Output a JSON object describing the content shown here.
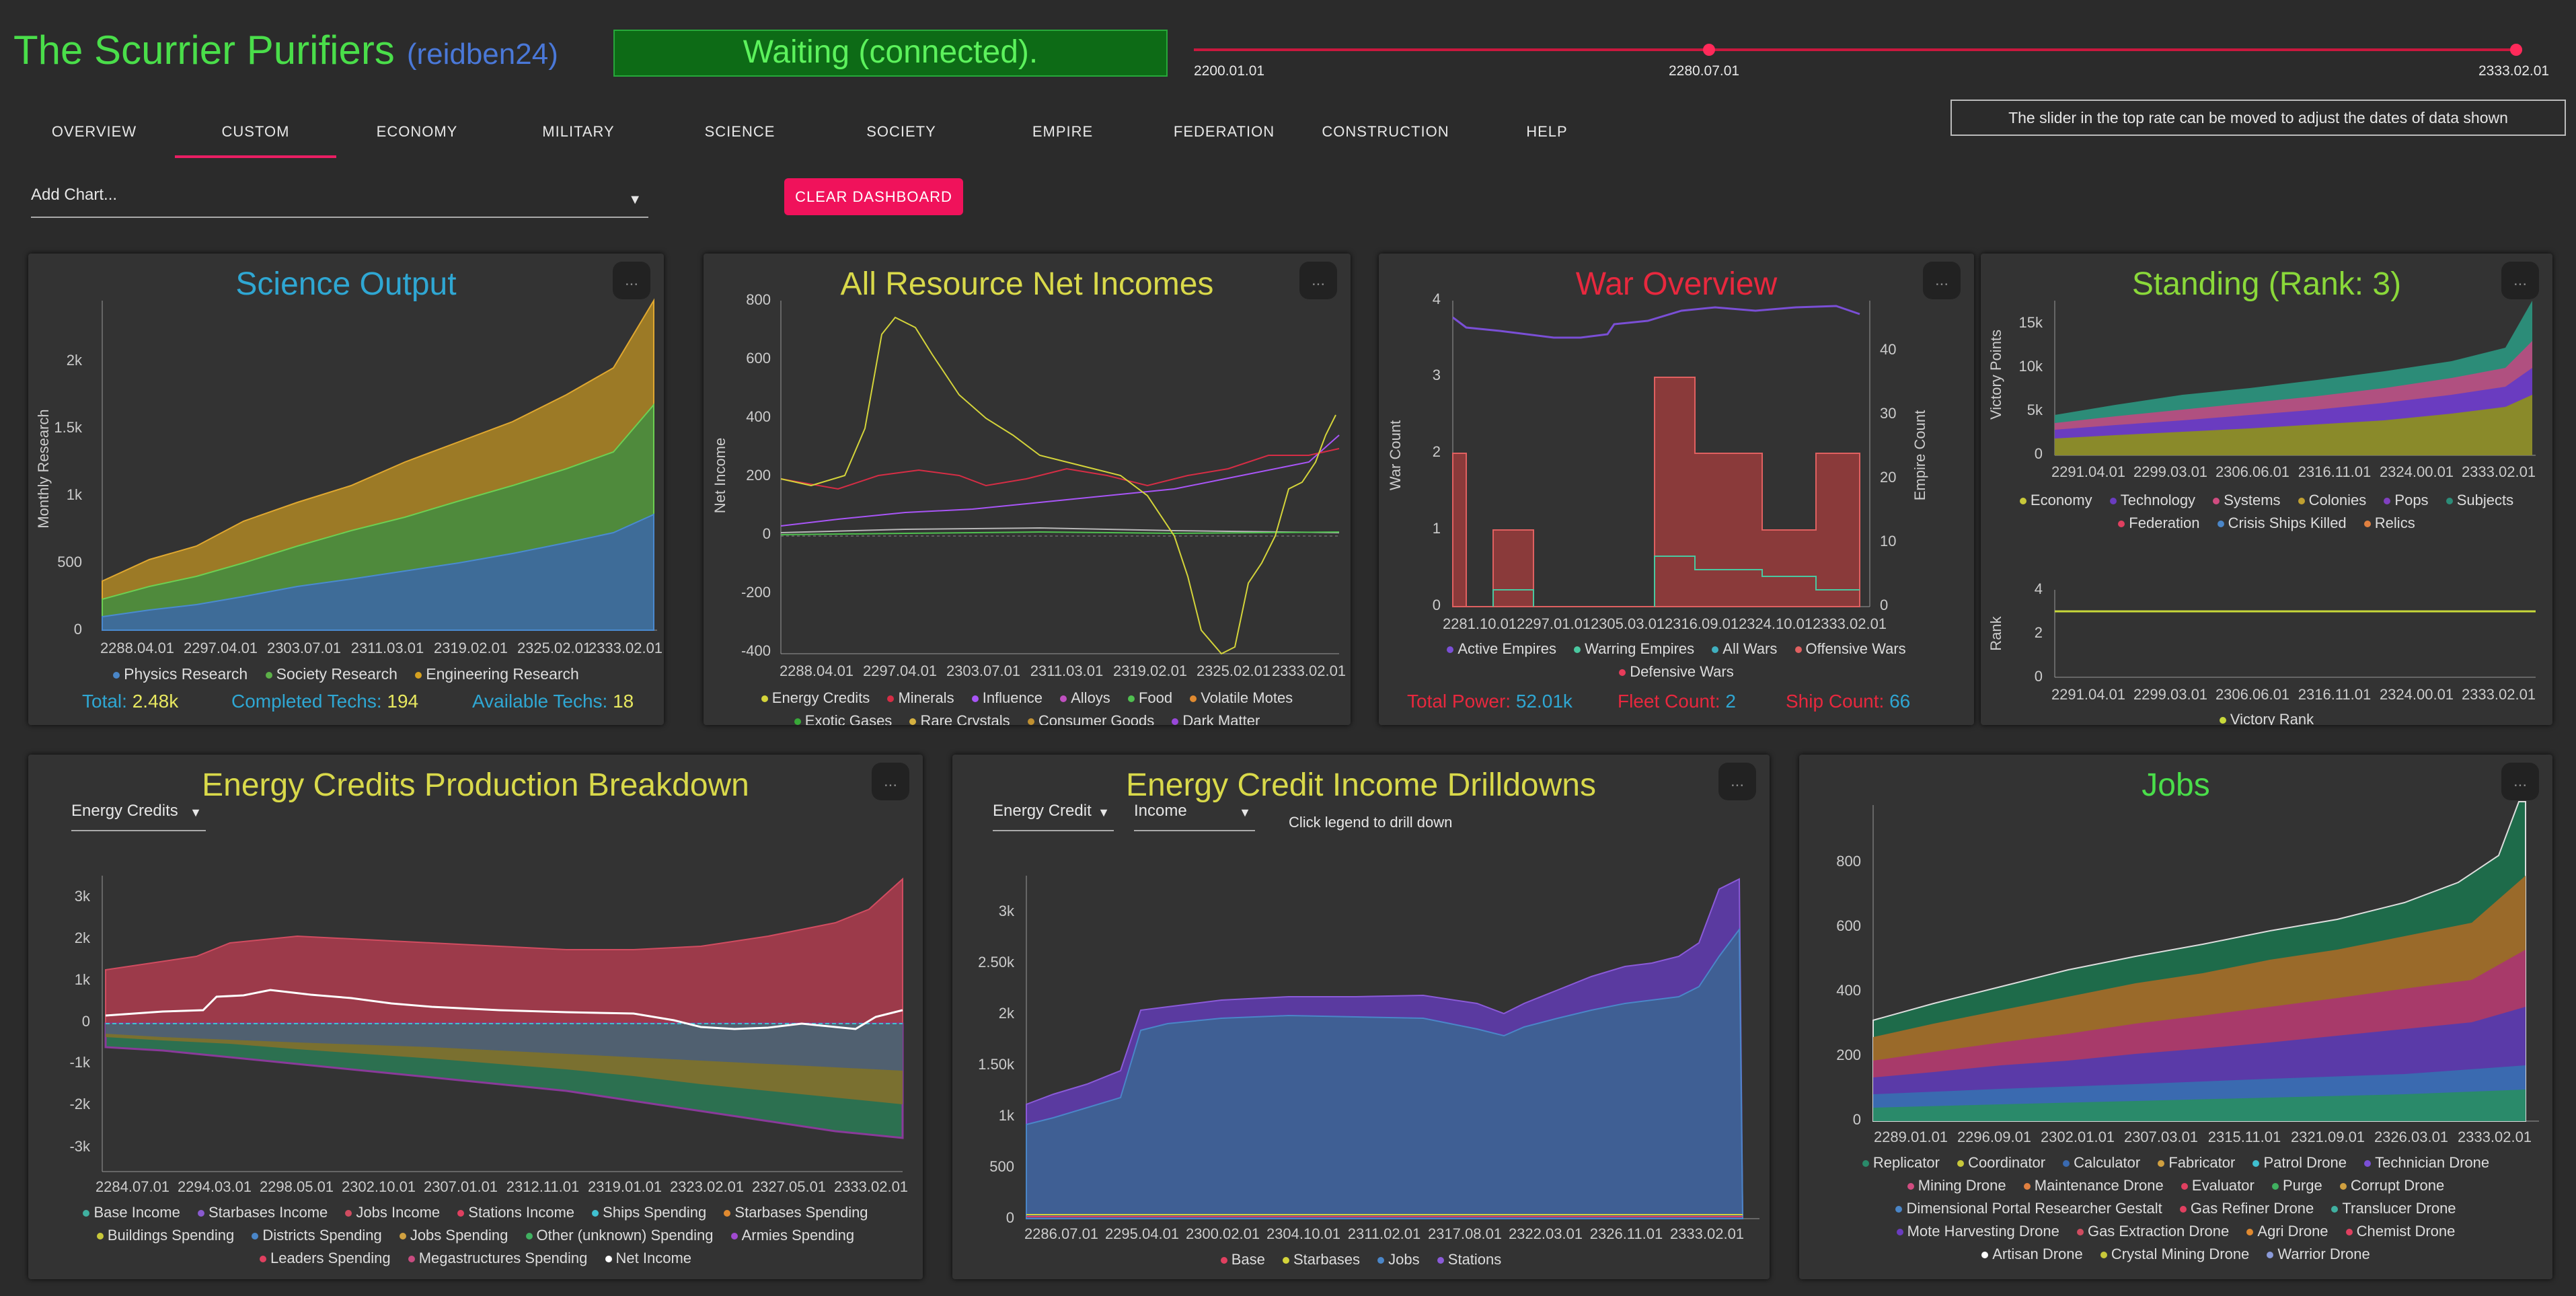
{
  "header": {
    "empire_name": "The Scurrier Purifiers",
    "user": "(reidben24)",
    "status": "Waiting (connected).",
    "slider": {
      "start": "2200.01.01",
      "selected": "2280.07.01",
      "end": "2333.02.01",
      "selected_fraction": 0.6
    }
  },
  "nav": {
    "tabs": [
      "OVERVIEW",
      "CUSTOM",
      "ECONOMY",
      "MILITARY",
      "SCIENCE",
      "SOCIETY",
      "EMPIRE",
      "FEDERATION",
      "CONSTRUCTION",
      "HELP"
    ],
    "active": "CUSTOM"
  },
  "hint": "The slider in the top rate can be moved to adjust the dates of data shown",
  "add_chart_placeholder": "Add Chart...",
  "clear_dashboard": "CLEAR DASHBOARD",
  "menu_label": "...",
  "colors": {
    "green": "#4ade4a",
    "blue": "#2fa7d3",
    "yellow": "#d9d94a",
    "red": "#e8283e",
    "physics": "#4a86c8",
    "society": "#5cb048",
    "engineering": "#d4a020",
    "purple": "#7a4fd6"
  },
  "panels": {
    "science": {
      "title": "Science Output",
      "ylabel": "Monthly Research",
      "yticks": [
        "0",
        "500",
        "1k",
        "1.5k",
        "2k"
      ],
      "xticks": [
        "2288.04.01",
        "2297.04.01",
        "2303.07.01",
        "2311.03.01",
        "2319.02.01",
        "2325.02.01",
        "2333.02.01"
      ],
      "legend": [
        "Physics Research",
        "Society Research",
        "Engineering Research"
      ],
      "stats": {
        "total_label": "Total:",
        "total": "2.48k",
        "completed_label": "Completed Techs:",
        "completed": "194",
        "available_label": "Available Techs:",
        "available": "18"
      }
    },
    "resources": {
      "title": "All Resource Net Incomes",
      "ylabel": "Net Income",
      "yticks": [
        "-400",
        "-200",
        "0",
        "200",
        "400",
        "600",
        "800"
      ],
      "xticks": [
        "2288.04.01",
        "2297.04.01",
        "2303.07.01",
        "2311.03.01",
        "2319.02.01",
        "2325.02.01",
        "2333.02.01"
      ],
      "legend_rows": [
        [
          "Energy Credits",
          "Minerals",
          "Influence",
          "Alloys",
          "Food",
          "Volatile Motes"
        ],
        [
          "Exotic Gases",
          "Rare Crystals",
          "Consumer Goods",
          "Dark Matter"
        ]
      ]
    },
    "war": {
      "title": "War Overview",
      "ylabel": "War Count",
      "y2label": "Empire Count",
      "yticks": [
        "0",
        "1",
        "2",
        "3",
        "4"
      ],
      "y2ticks": [
        "0",
        "10",
        "20",
        "30",
        "40"
      ],
      "xticks": [
        "2281.10.01",
        "2297.01.01",
        "2305.03.01",
        "2316.09.01",
        "2324.10.01",
        "2333.02.01"
      ],
      "legend_rows": [
        [
          "Active Empires",
          "Warring Empires",
          "All Wars",
          "Offensive Wars"
        ],
        [
          "Defensive Wars"
        ]
      ],
      "stats": {
        "power_label": "Total Power:",
        "power": "52.01k",
        "fleet_label": "Fleet Count:",
        "fleet": "2",
        "ships_label": "Ship Count:",
        "ships": "66"
      }
    },
    "standing": {
      "title": "Standing (Rank: 3)",
      "ylabel": "Victory Points",
      "yticks": [
        "0",
        "5k",
        "10k",
        "15k"
      ],
      "xticks": [
        "2291.04.01",
        "2299.03.01",
        "2306.06.01",
        "2316.11.01",
        "2324.00.01",
        "2333.02.01"
      ],
      "legend_rows": [
        [
          "Economy",
          "Technology",
          "Systems",
          "Colonies",
          "Pops",
          "Subjects"
        ],
        [
          "Federation",
          "Crisis Ships Killed",
          "Relics"
        ]
      ],
      "rank_label": "Rank",
      "rank_yticks": [
        "0",
        "2",
        "4"
      ],
      "rank_legend": "Victory Rank",
      "rank_value": 3
    },
    "energy": {
      "title": "Energy Credits Production Breakdown",
      "select": "Energy Credits",
      "yticks": [
        "-3k",
        "-2k",
        "-1k",
        "0",
        "1k",
        "2k",
        "3k"
      ],
      "xticks": [
        "2284.07.01",
        "2294.03.01",
        "2298.05.01",
        "2302.10.01",
        "2307.01.01",
        "2312.11.01",
        "2319.01.01",
        "2323.02.01",
        "2327.05.01",
        "2333.02.01"
      ],
      "legend_rows": [
        [
          "Base Income",
          "Starbases Income",
          "Jobs Income",
          "Stations Income",
          "Ships Spending",
          "Starbases Spending"
        ],
        [
          "Buildings Spending",
          "Districts Spending",
          "Jobs Spending",
          "Other (unknown) Spending",
          "Armies Spending"
        ],
        [
          "Leaders Spending",
          "Megastructures Spending",
          "Net Income"
        ]
      ]
    },
    "drill": {
      "title": "Energy Credit Income Drilldowns",
      "select1": "Energy Credit",
      "select2": "Income",
      "note": "Click legend to drill down",
      "yticks": [
        "0",
        "500",
        "1k",
        "1.50k",
        "2k",
        "2.50k",
        "3k"
      ],
      "xticks": [
        "2286.07.01",
        "2295.04.01",
        "2300.02.01",
        "2304.10.01",
        "2311.02.01",
        "2317.08.01",
        "2322.03.01",
        "2326.11.01",
        "2333.02.01"
      ],
      "legend": [
        "Base",
        "Starbases",
        "Jobs",
        "Stations"
      ]
    },
    "jobs": {
      "title": "Jobs",
      "yticks": [
        "0",
        "200",
        "400",
        "600",
        "800"
      ],
      "xticks": [
        "2289.01.01",
        "2296.09.01",
        "2302.01.01",
        "2307.03.01",
        "2315.11.01",
        "2321.09.01",
        "2326.03.01",
        "2333.02.01"
      ],
      "legend_rows": [
        [
          "Replicator",
          "Coordinator",
          "Calculator",
          "Fabricator",
          "Patrol Drone",
          "Technician Drone"
        ],
        [
          "Mining Drone",
          "Maintenance Drone",
          "Evaluator",
          "Purge",
          "Corrupt Drone"
        ],
        [
          "Dimensional Portal Researcher Gestalt",
          "Gas Refiner Drone",
          "Translucer Drone"
        ],
        [
          "Mote Harvesting Drone",
          "Gas Extraction Drone",
          "Agri Drone",
          "Chemist Drone"
        ],
        [
          "Artisan Drone",
          "Crystal Mining Drone",
          "Warrior Drone"
        ]
      ]
    }
  }
}
